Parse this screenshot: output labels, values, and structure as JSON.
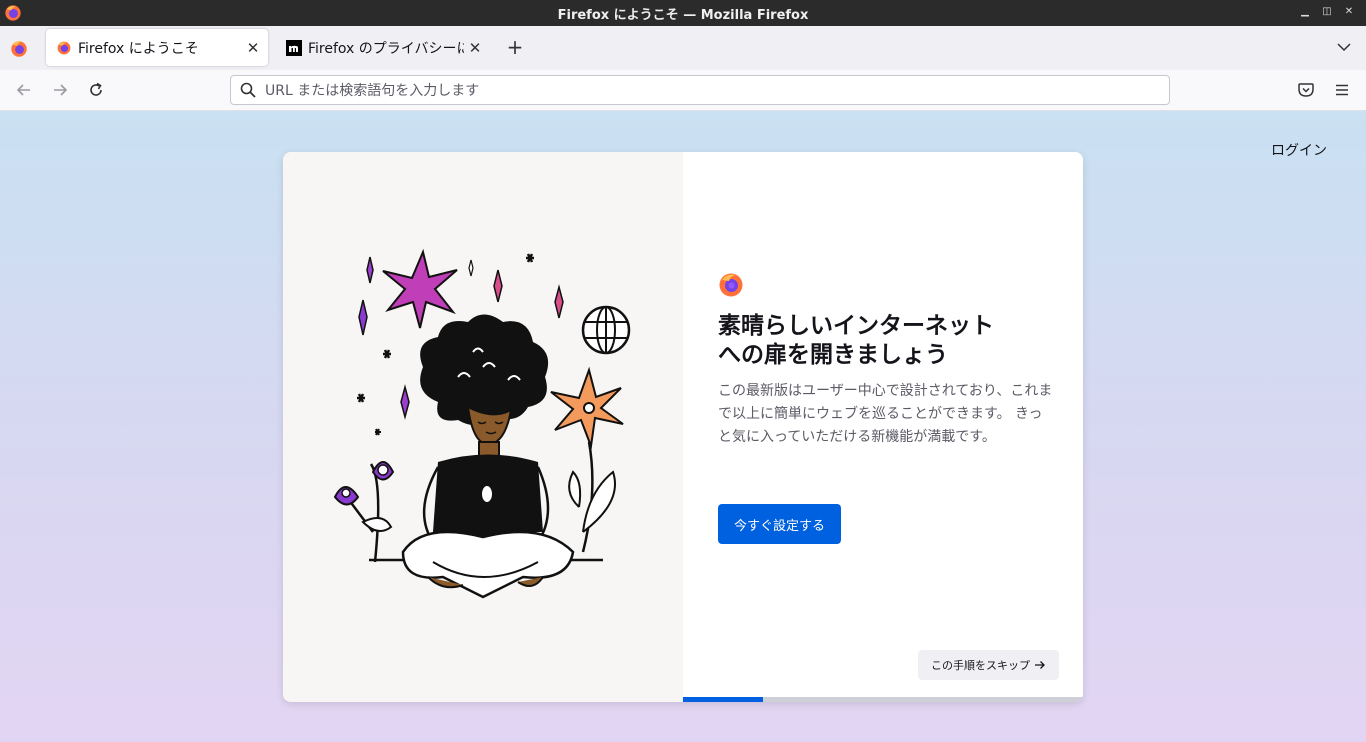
{
  "window": {
    "title": "Firefox にようこそ — Mozilla Firefox"
  },
  "tabs": [
    {
      "label": "Firefox にようこそ",
      "active": true
    },
    {
      "label": "Firefox のプライバシーに関",
      "active": false
    }
  ],
  "toolbar": {
    "url_placeholder": "URL または検索語句を入力します"
  },
  "page": {
    "login_label": "ログイン",
    "title_line1": "素晴らしいインターネット",
    "title_line2": "への扉を開きましょう",
    "body": "この最新版はユーザー中心で設計されており、これまで以上に簡単にウェブを巡ることができます。 きっと気に入っていただける新機能が満載です。",
    "primary_button": "今すぐ設定する",
    "skip_button": "この手順をスキップ",
    "progress_fraction": 0.2
  },
  "colors": {
    "accent": "#0061e0",
    "title_bar": "#2b2b2b"
  },
  "icons": [
    "firefox-logo-icon",
    "firefox-view-icon",
    "close-icon",
    "plus-icon",
    "chevron-down-icon",
    "back-arrow-icon",
    "forward-arrow-icon",
    "reload-icon",
    "search-icon",
    "pocket-icon",
    "hamburger-menu-icon",
    "arrow-right-icon"
  ]
}
